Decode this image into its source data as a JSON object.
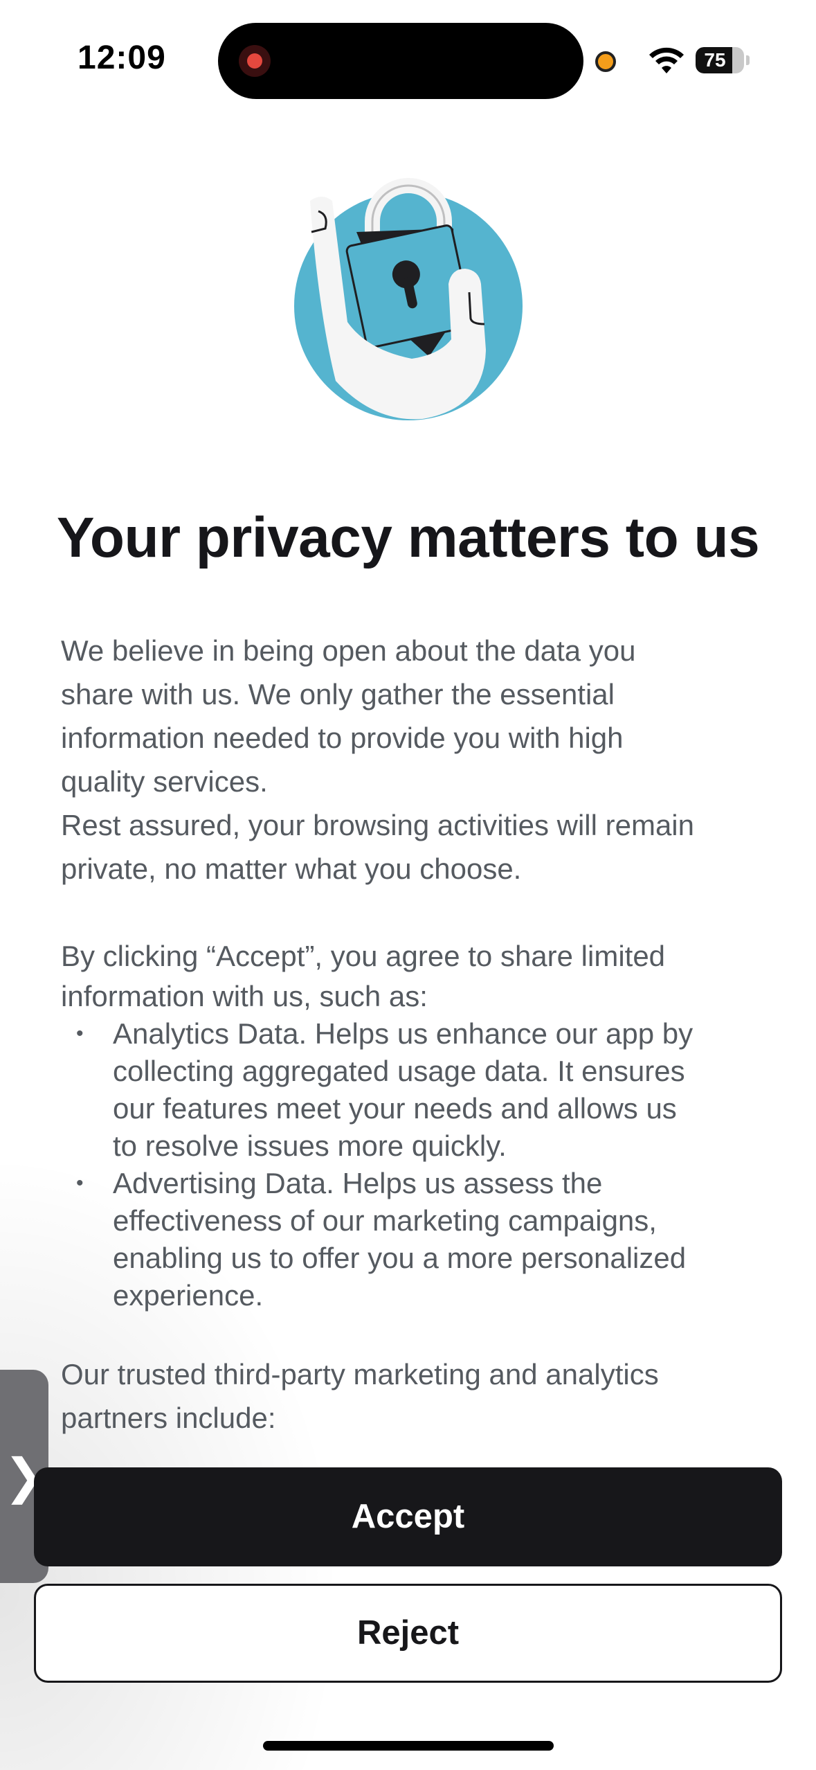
{
  "status_bar": {
    "time": "12:09",
    "battery_level": 75,
    "battery_text": "75"
  },
  "illustration": {
    "icon": "hand-holding-padlock",
    "circle_color": "#55b4cf"
  },
  "title": "Your privacy matters to us",
  "intro": {
    "lines": [
      "We believe in being open about the data you",
      "share with us. We only gather the essential",
      "information needed to provide you with high",
      "quality services.",
      "Rest assured, your browsing activities will remain",
      "private, no matter what you choose."
    ]
  },
  "consent": {
    "lines": [
      "By clicking “Accept”, you agree to share limited",
      "information with us, such as:"
    ],
    "bullet_symbol": "•",
    "bullets": [
      {
        "lines": [
          "Analytics Data. Helps us enhance our app by",
          "collecting aggregated usage data. It ensures",
          "our features meet your needs and allows us",
          "to resolve issues more quickly."
        ]
      },
      {
        "lines": [
          "Advertising Data. Helps us assess the",
          "effectiveness of our marketing campaigns,",
          "enabling us to offer you a more personalized",
          "experience."
        ]
      }
    ]
  },
  "partners": {
    "lines": [
      "Our trusted third-party marketing and analytics",
      "partners include:"
    ]
  },
  "side_handle": {
    "glyph": "❯"
  },
  "buttons": {
    "accept": "Accept",
    "reject": "Reject"
  },
  "colors": {
    "primary_button": "#17171a",
    "text_body": "#555a60",
    "accent_circle": "#55b4cf"
  }
}
